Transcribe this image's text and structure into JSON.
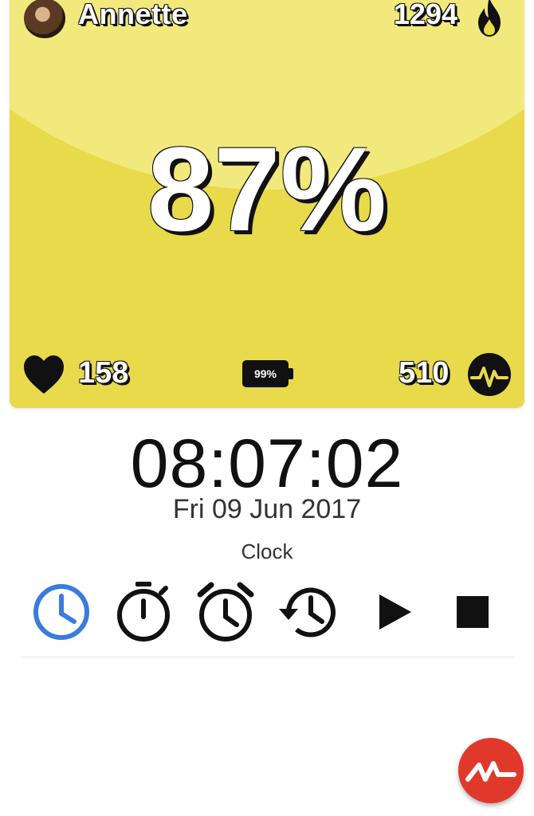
{
  "header": {
    "user_name": "Annette",
    "calories": "1294"
  },
  "main": {
    "effort_percent": "87%",
    "heart_rate": "158",
    "battery": "99%",
    "points": "510"
  },
  "clock": {
    "time": "08:07:02",
    "date": "Fri 09 Jun 2017",
    "mode_label": "Clock"
  },
  "toolbar": {
    "items": [
      "clock-icon",
      "stopwatch-icon",
      "alarm-icon",
      "history-icon",
      "play-icon",
      "stop-icon"
    ],
    "active_color": "#3a7be0"
  },
  "colors": {
    "card": "#e8da4a",
    "card_top": "#f2e97c",
    "fab": "#e0392b"
  }
}
